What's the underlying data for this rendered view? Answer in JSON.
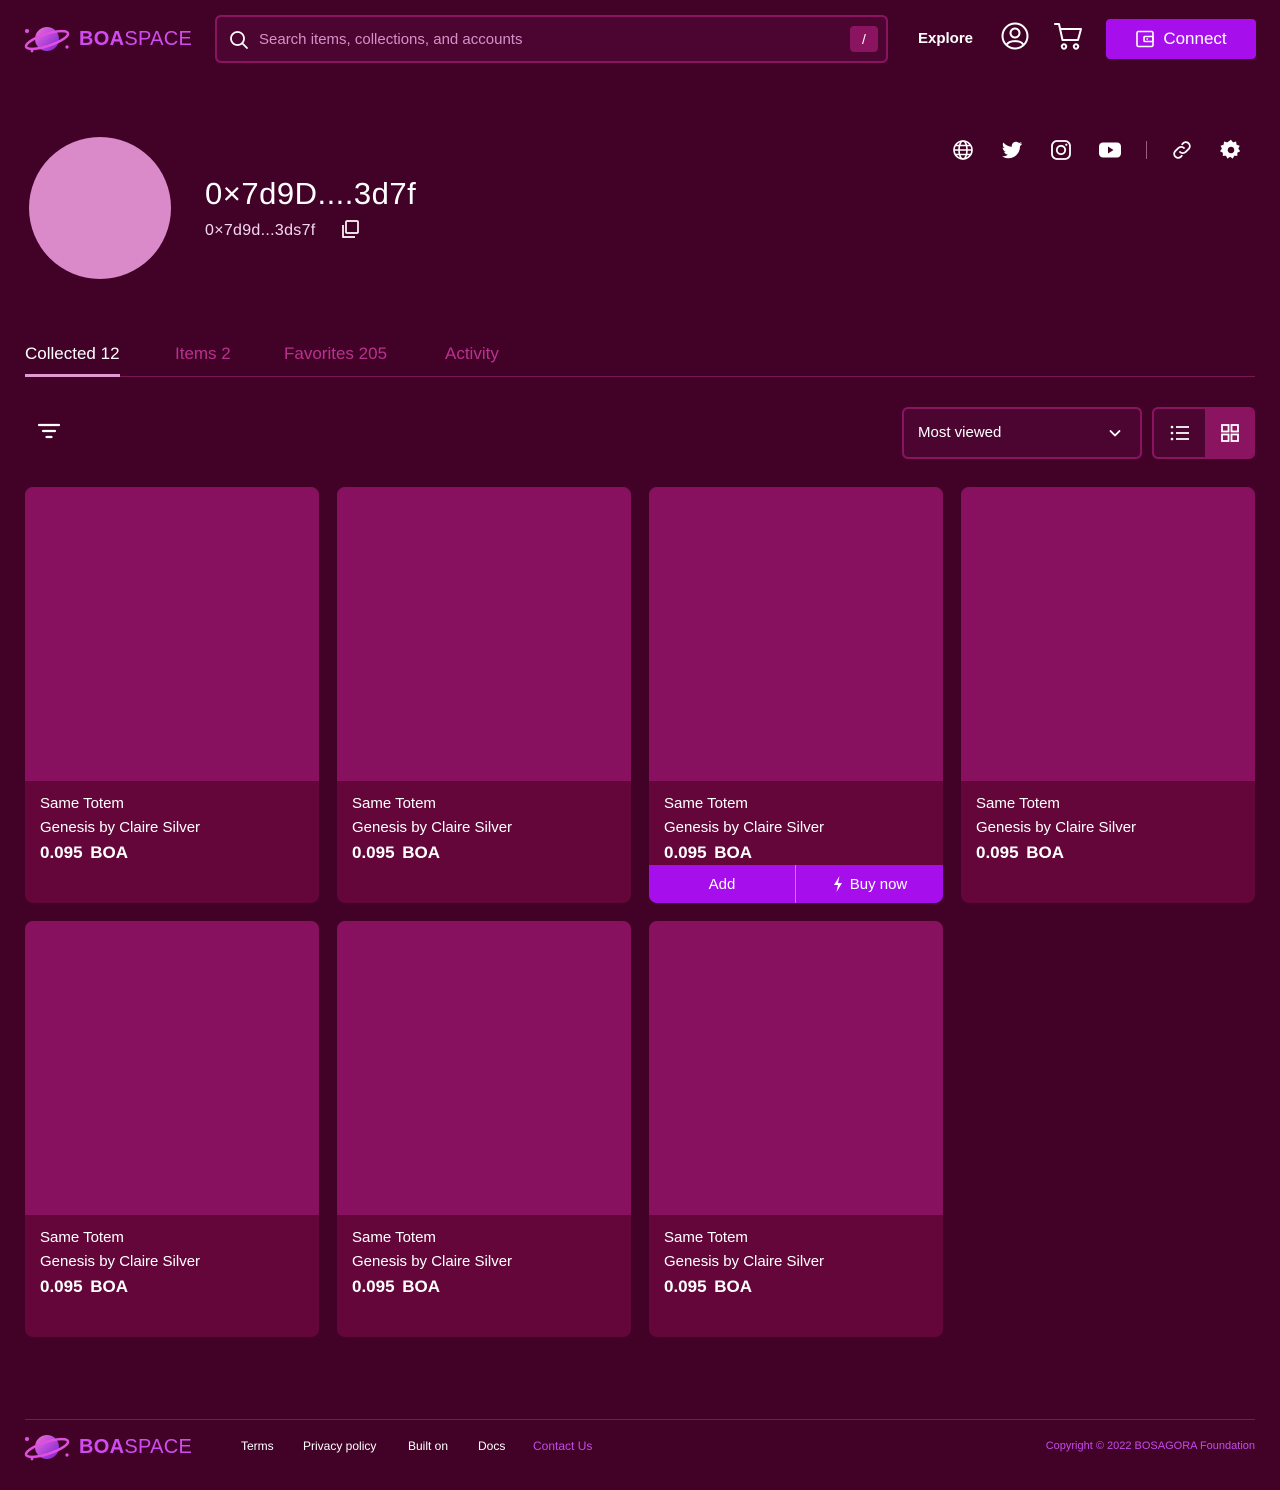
{
  "header": {
    "logo": {
      "bold": "BOA",
      "light": "SPACE"
    },
    "search": {
      "placeholder": "Search items, collections, and accounts",
      "shortcut": "/"
    },
    "nav": {
      "explore": "Explore"
    },
    "connect_label": "Connect"
  },
  "profile": {
    "name": "0×7d9D....3d7f",
    "address": "0×7d9d...3ds7f",
    "social_icons": [
      "globe-icon",
      "twitter-icon",
      "instagram-icon",
      "youtube-icon",
      "link-icon",
      "settings-icon"
    ]
  },
  "tabs": [
    {
      "label": "Collected",
      "count": "12",
      "active": true
    },
    {
      "label": "Items",
      "count": "2",
      "active": false
    },
    {
      "label": "Favorites",
      "count": "205",
      "active": false
    },
    {
      "label": "Activity",
      "count": "",
      "active": false
    }
  ],
  "toolbar": {
    "sort_selected": "Most viewed",
    "view_mode": "grid"
  },
  "cards": [
    {
      "title": "Same Totem",
      "subtitle": "Genesis by Claire Silver",
      "price": "0.095",
      "currency": "BOA"
    },
    {
      "title": "Same Totem",
      "subtitle": "Genesis by Claire Silver",
      "price": "0.095",
      "currency": "BOA"
    },
    {
      "title": "Same Totem",
      "subtitle": "Genesis by Claire Silver",
      "price": "0.095",
      "currency": "BOA",
      "hover": true
    },
    {
      "title": "Same Totem",
      "subtitle": "Genesis by Claire Silver",
      "price": "0.095",
      "currency": "BOA"
    },
    {
      "title": "Same Totem",
      "subtitle": "Genesis by Claire Silver",
      "price": "0.095",
      "currency": "BOA"
    },
    {
      "title": "Same Totem",
      "subtitle": "Genesis by Claire Silver",
      "price": "0.095",
      "currency": "BOA"
    },
    {
      "title": "Same Totem",
      "subtitle": "Genesis by Claire Silver",
      "price": "0.095",
      "currency": "BOA"
    }
  ],
  "card_actions": {
    "add": "Add",
    "buy": "Buy now"
  },
  "footer": {
    "links": [
      "Terms",
      "Privacy policy",
      "Built on",
      "Docs",
      "Contact Us"
    ],
    "copyright": "Copyright © 2022 BOSAGORA Foundation"
  },
  "colors": {
    "background": "#420228",
    "card": "#640639",
    "card_image": "#87115f",
    "accent": "#a60eeb",
    "tab_inactive": "#b9328e"
  }
}
